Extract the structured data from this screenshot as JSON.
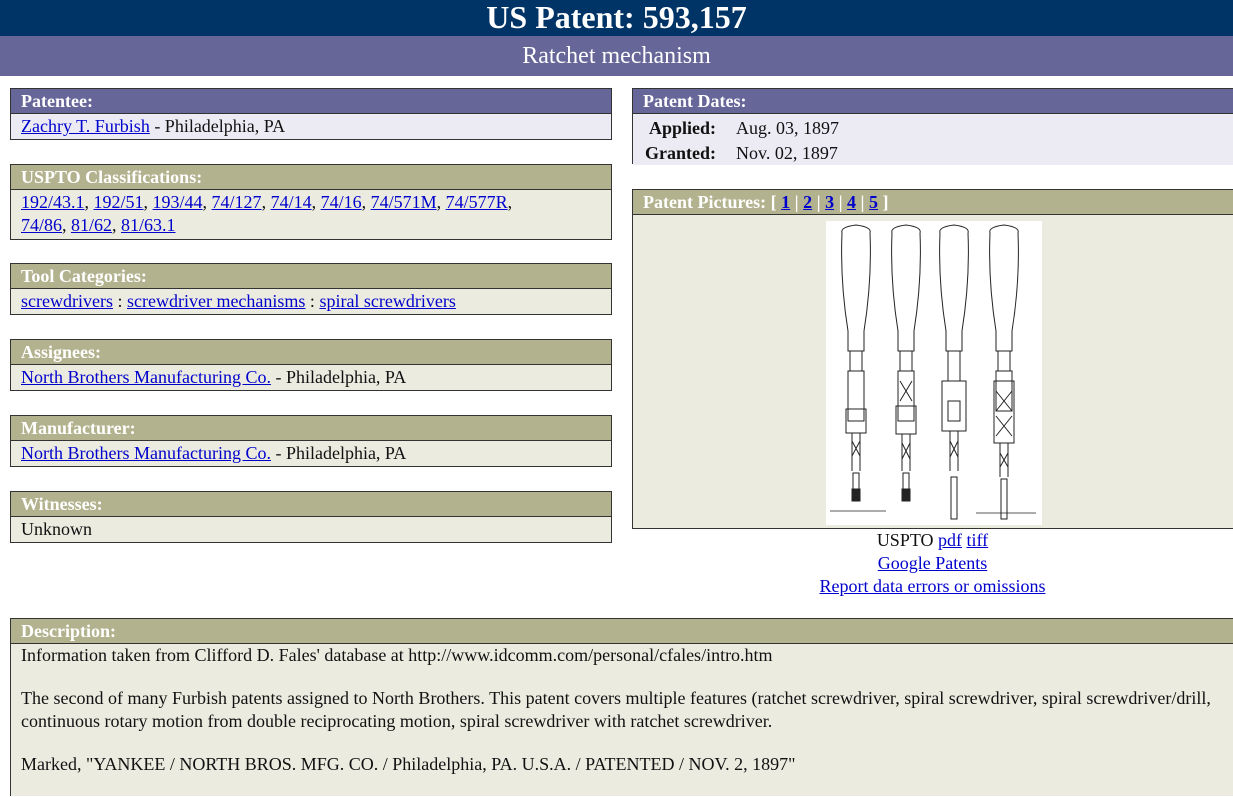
{
  "header": {
    "title": "US Patent: 593,157",
    "subtitle": "Ratchet mechanism"
  },
  "patentee": {
    "heading": "Patentee:",
    "name": "Zachry T. Furbish",
    "location": " - Philadelphia, PA"
  },
  "classifications": {
    "heading": "USPTO Classifications:",
    "items": [
      "192/43.1",
      "192/51",
      "193/44",
      "74/127",
      "74/14",
      "74/16",
      "74/571M",
      "74/577R",
      "74/86",
      "81/62",
      "81/63.1"
    ]
  },
  "tool_categories": {
    "heading": "Tool Categories:",
    "items": [
      "screwdrivers",
      "screwdriver mechanisms",
      "spiral screwdrivers"
    ],
    "separator": " : "
  },
  "assignees": {
    "heading": "Assignees:",
    "name": "North Brothers Manufacturing Co.",
    "location": " - Philadelphia, PA"
  },
  "manufacturer": {
    "heading": "Manufacturer:",
    "name": "North Brothers Manufacturing Co.",
    "location": " - Philadelphia, PA"
  },
  "witnesses": {
    "heading": "Witnesses:",
    "value": "Unknown"
  },
  "dates": {
    "heading": "Patent Dates:",
    "applied_label": "Applied:",
    "applied": "Aug. 03, 1897",
    "granted_label": "Granted:",
    "granted": "Nov. 02, 1897"
  },
  "pictures": {
    "heading": "Patent Pictures:",
    "pages": [
      "1",
      "2",
      "3",
      "4",
      "5"
    ],
    "open_bracket": "[",
    "close_bracket": "]",
    "separator": "|"
  },
  "external_links": {
    "uspto_label": "USPTO",
    "pdf": "pdf",
    "tiff": "tiff",
    "google": "Google Patents",
    "report": "Report data errors or omissions "
  },
  "description": {
    "heading": "Description:",
    "paragraphs": [
      "Information taken from Clifford D. Fales' database at http://www.idcomm.com/personal/cfales/intro.htm",
      "The second of many Furbish patents assigned to North Brothers. This patent covers multiple features (ratchet screwdriver, spiral screwdriver, spiral screwdriver/drill, continuous rotary motion from double reciprocating motion, spiral screwdriver with ratchet screwdriver.",
      "Marked, \"YANKEE / NORTH BROS. MFG. CO. / Philadelphia, PA. U.S.A. / PATENTED / NOV. 2, 1897\""
    ]
  }
}
